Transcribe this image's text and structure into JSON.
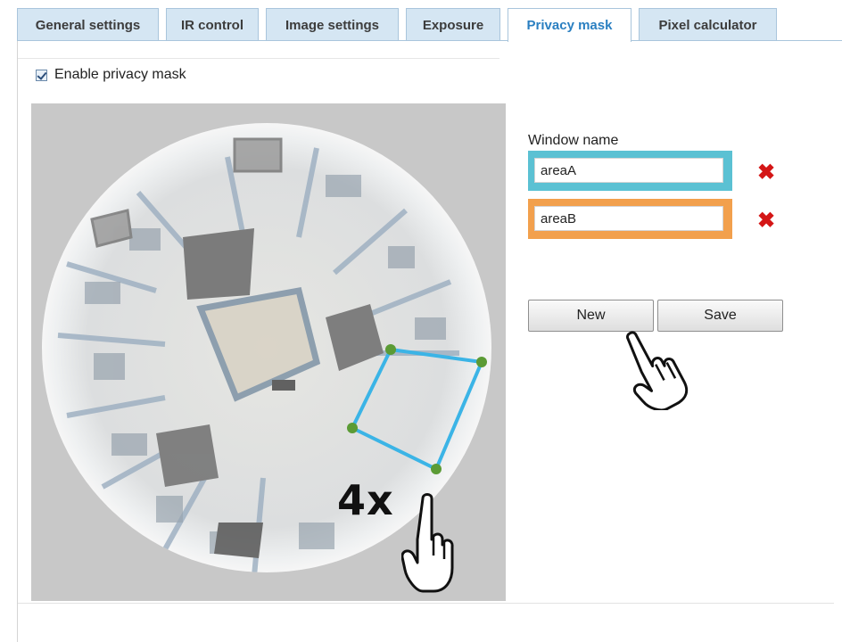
{
  "tabs": [
    {
      "label": "General settings",
      "active": false
    },
    {
      "label": "IR control",
      "active": false
    },
    {
      "label": "Image settings",
      "active": false
    },
    {
      "label": "Exposure",
      "active": false
    },
    {
      "label": "Privacy mask",
      "active": true
    },
    {
      "label": "Pixel calculator",
      "active": false
    }
  ],
  "enable": {
    "label": "Enable privacy mask",
    "checked": true
  },
  "preview": {
    "type": "fisheye camera view",
    "annotation": "4x"
  },
  "mask_windows": {
    "label": "Window name",
    "items": [
      {
        "name": "areaA",
        "color": "#5bc1d3"
      },
      {
        "name": "areaB",
        "color": "#f2a04d"
      }
    ],
    "delete_icon": "red-x-icon"
  },
  "buttons": {
    "new_label": "New",
    "save_label": "Save"
  },
  "colors": {
    "tab_bg": "#d5e6f3",
    "active_tab_text": "#2a7fc1",
    "mask_outline": "#3bb4e6",
    "handle": "#5b9b35",
    "delete": "#d41616"
  }
}
